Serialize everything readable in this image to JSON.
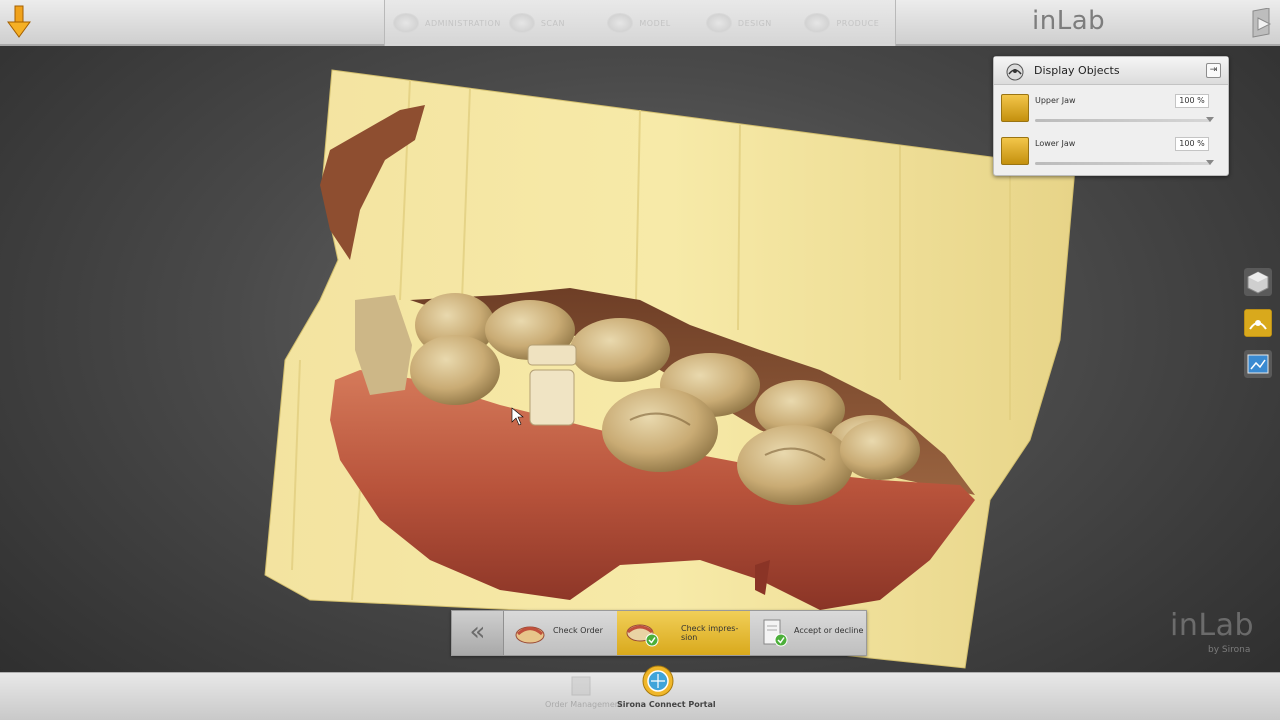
{
  "app": {
    "logo": "inLab",
    "watermark_logo": "inLab",
    "watermark_sub": "by Sirona"
  },
  "phases": [
    {
      "label": "ADMINISTRATION"
    },
    {
      "label": "SCAN"
    },
    {
      "label": "MODEL"
    },
    {
      "label": "DESIGN"
    },
    {
      "label": "PRODUCE"
    }
  ],
  "display_objects": {
    "title": "Display Objects",
    "pin_glyph": "⇥",
    "items": [
      {
        "label": "Upper Jaw",
        "value": "100 %",
        "opacity_percent": 100
      },
      {
        "label": "Lower Jaw",
        "value": "100 %",
        "opacity_percent": 100
      }
    ]
  },
  "steps": {
    "back_glyph": "«",
    "items": [
      {
        "label": "Check Order",
        "active": false
      },
      {
        "label": "Check impres-\nsion",
        "active": true
      },
      {
        "label": "Accept or decline",
        "active": false
      }
    ]
  },
  "bottom": {
    "items": [
      {
        "label": "Order Management",
        "active": false
      },
      {
        "label": "Sirona Connect Portal",
        "active": true
      }
    ]
  },
  "colors": {
    "accent": "#e8bb2e",
    "model_stone": "#f0e095",
    "gingiva": "#c05a3c",
    "tooth": "#cdb27e"
  },
  "icons": {
    "top_left": "download-arrow-icon",
    "top_right": "exit-icon",
    "panel": "display-objects-icon",
    "side_tools": [
      "cube-view-icon",
      "tooth-model-icon",
      "screenshot-icon"
    ]
  }
}
